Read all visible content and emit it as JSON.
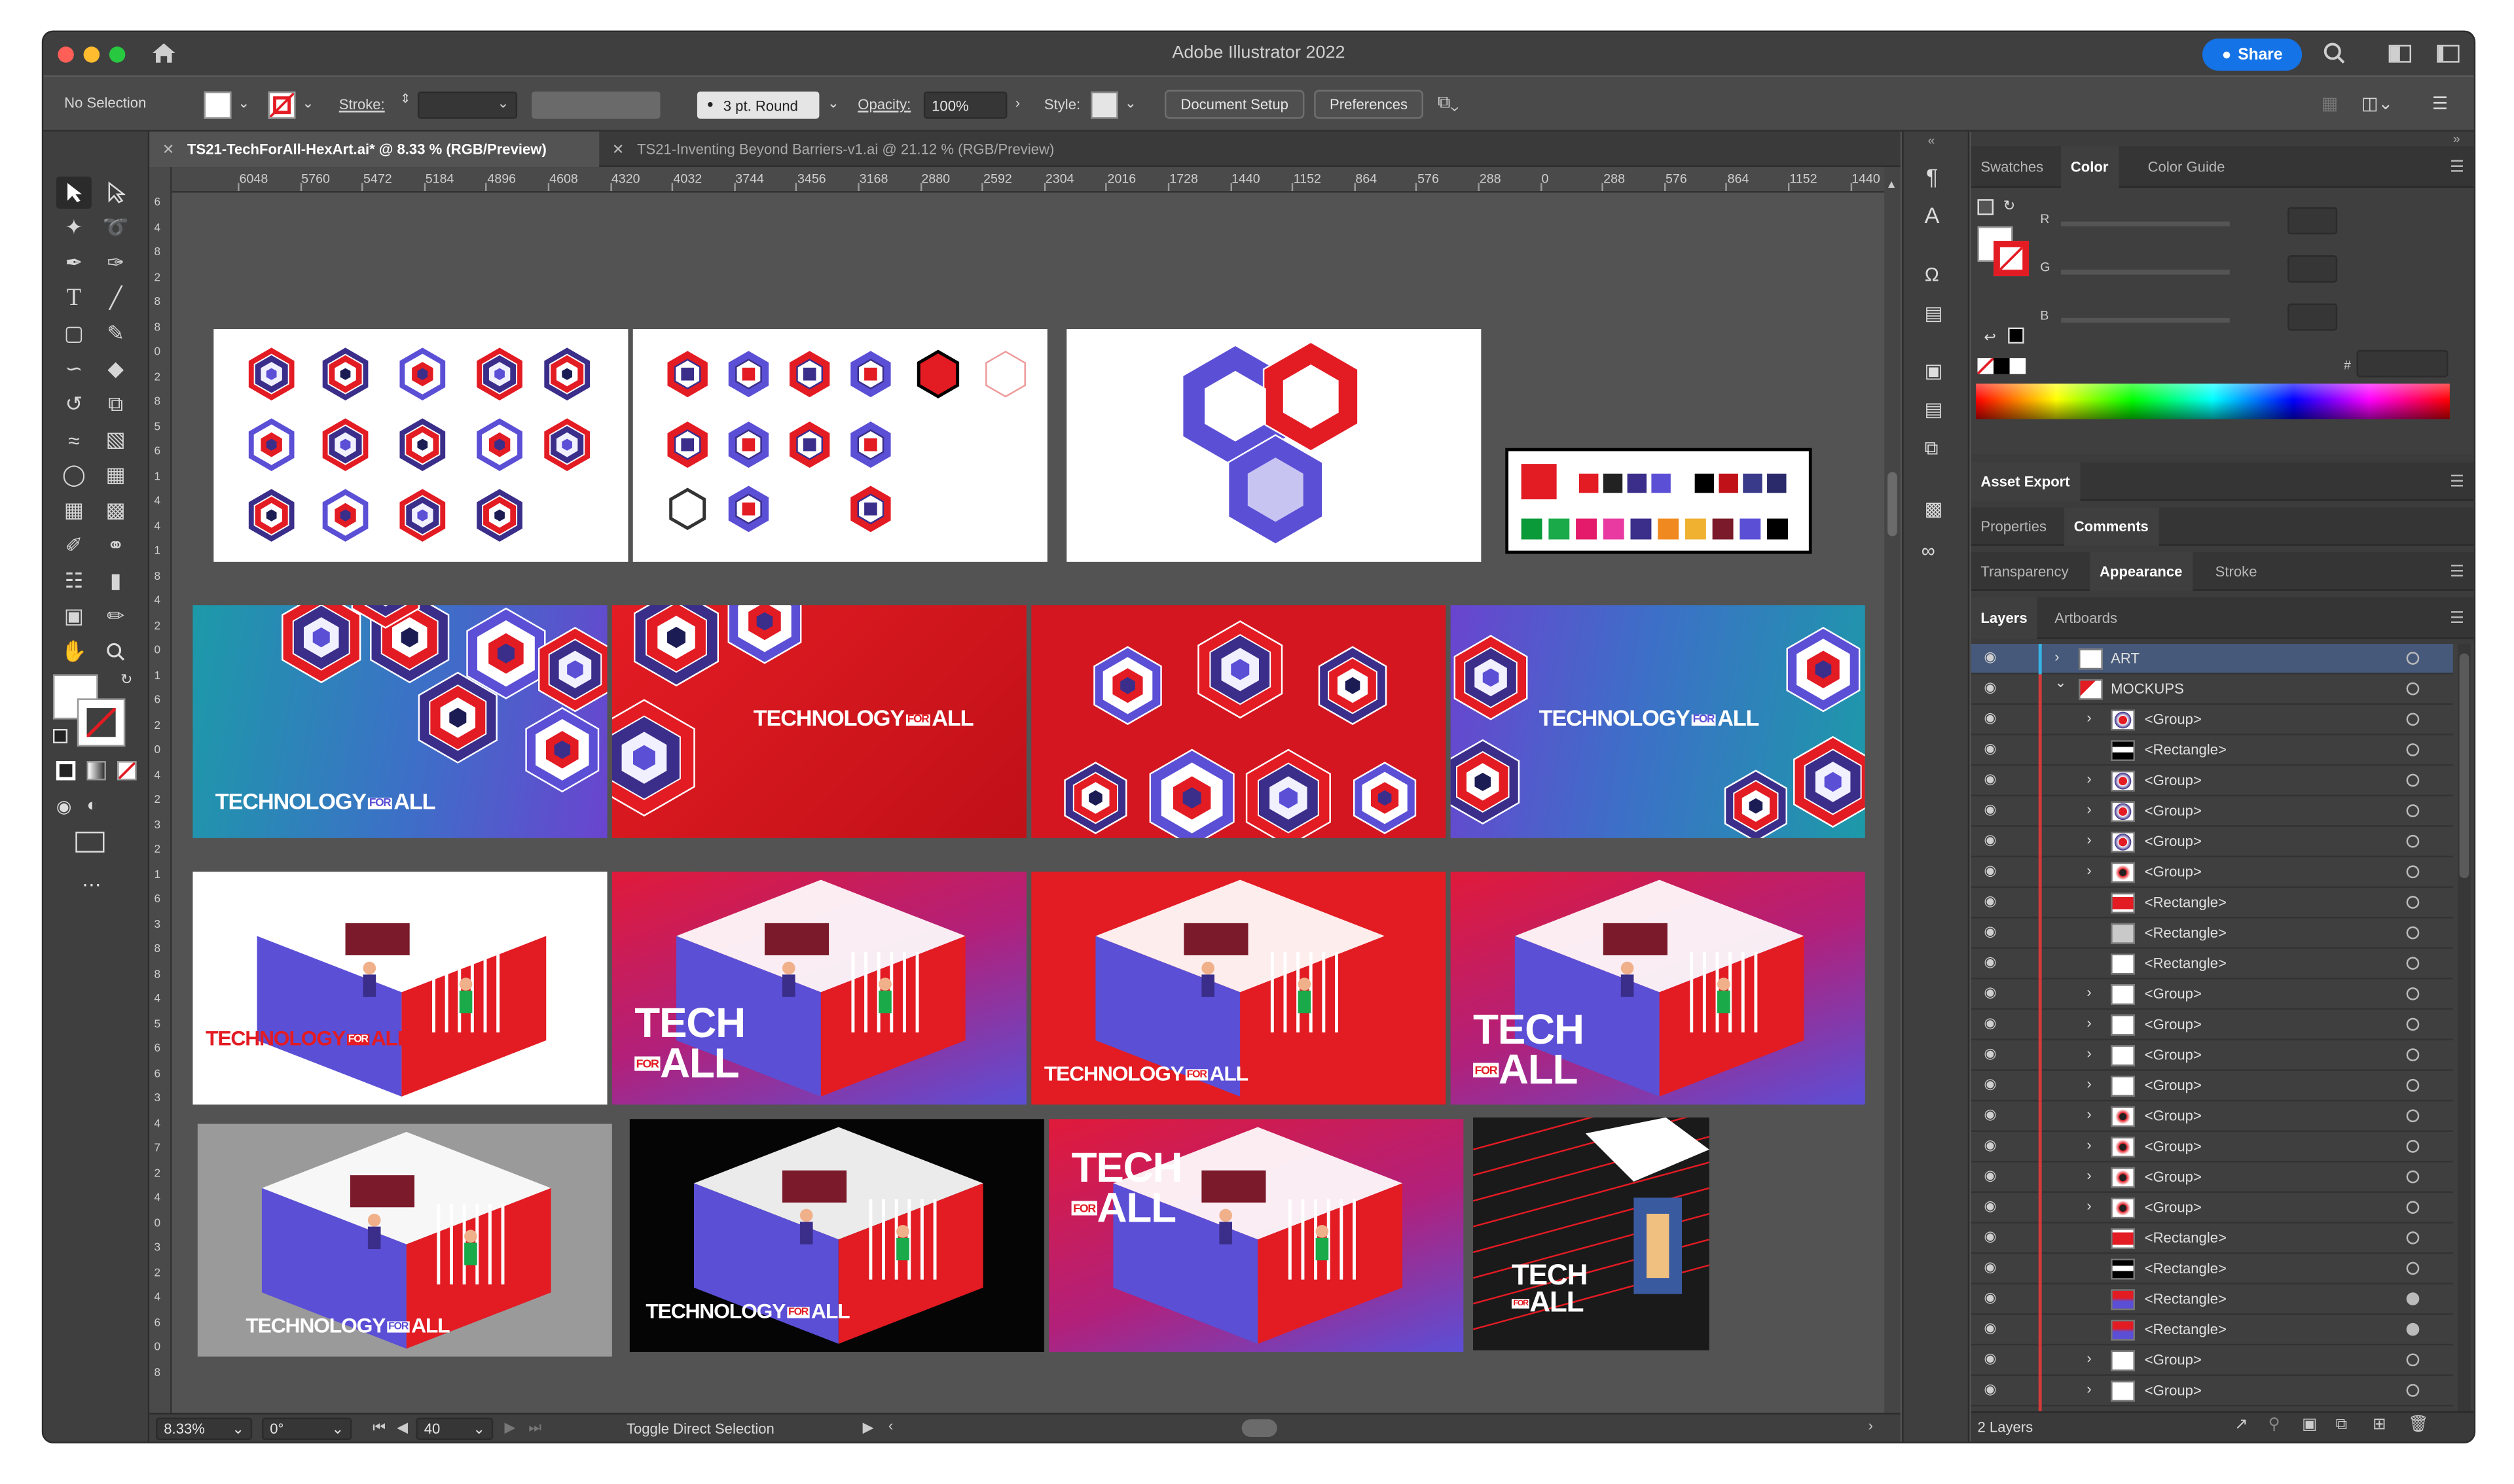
{
  "app": {
    "title": "Adobe Illustrator 2022",
    "share_label": "Share"
  },
  "control_bar": {
    "selection": "No Selection",
    "stroke_label": "Stroke:",
    "brush": "3 pt. Round",
    "opacity_label": "Opacity:",
    "opacity_value": "100%",
    "style_label": "Style:",
    "document_setup": "Document Setup",
    "preferences": "Preferences"
  },
  "tabs": [
    {
      "label": "TS21-TechForAll-HexArt.ai* @ 8.33 % (RGB/Preview)",
      "active": true
    },
    {
      "label": "TS21-Inventing Beyond Barriers-v1.ai @ 21.12 % (RGB/Preview)",
      "active": false
    }
  ],
  "ruler_top": [
    "6048",
    "5760",
    "5472",
    "5184",
    "4896",
    "4608",
    "4320",
    "4032",
    "3744",
    "3456",
    "3168",
    "2880",
    "2592",
    "2304",
    "2016",
    "1728",
    "1440",
    "1152",
    "864",
    "576",
    "288",
    "0",
    "288",
    "576",
    "864",
    "1152",
    "1440"
  ],
  "ruler_left": [
    "6",
    "4",
    "8",
    "2",
    "8",
    "8",
    "0",
    "2",
    "8",
    "5",
    "6",
    "1",
    "4",
    "4",
    "1",
    "8",
    "4",
    "2",
    "0",
    "1",
    "6",
    "2",
    "0",
    "4",
    "2",
    "3",
    "2",
    "1",
    "6",
    "3",
    "8",
    "8",
    "4",
    "5",
    "6",
    "6",
    "3",
    "4",
    "7",
    "2",
    "4",
    "0",
    "3",
    "2",
    "4",
    "6",
    "0",
    "8"
  ],
  "artboards": {
    "banner_text": {
      "technology": "TECHNOLOGY",
      "for": "FOR",
      "all": "ALL",
      "tech": "TECH"
    }
  },
  "status_bar": {
    "zoom": "8.33%",
    "rotation": "0°",
    "artboard_number": "40",
    "tool_hint": "Toggle Direct Selection"
  },
  "right_panel": {
    "color_tabs": [
      "Swatches",
      "Color",
      "Color Guide"
    ],
    "active_color_tab": "Color",
    "channels": [
      "R",
      "G",
      "B"
    ],
    "hex_symbol": "#",
    "asset_export": "Asset Export",
    "prop_tabs": [
      "Properties",
      "Comments"
    ],
    "appearance_tabs": [
      "Transparency",
      "Appearance",
      "Stroke"
    ],
    "layer_tabs": [
      "Layers",
      "Artboards"
    ],
    "layers": [
      {
        "name": "ART",
        "level": 0,
        "expand": "right",
        "thumb": "art"
      },
      {
        "name": "MOCKUPS",
        "level": 0,
        "expand": "down",
        "thumb": "mock"
      },
      {
        "name": "<Group>",
        "level": 1,
        "expand": "right",
        "thumb": "hexred"
      },
      {
        "name": "<Rectangle>",
        "level": 1,
        "expand": "",
        "thumb": "stripe"
      },
      {
        "name": "<Group>",
        "level": 1,
        "expand": "right",
        "thumb": "hexred"
      },
      {
        "name": "<Group>",
        "level": 1,
        "expand": "right",
        "thumb": "hexred"
      },
      {
        "name": "<Group>",
        "level": 1,
        "expand": "right",
        "thumb": "hexred"
      },
      {
        "name": "<Group>",
        "level": 1,
        "expand": "right",
        "thumb": "hexdark"
      },
      {
        "name": "<Rectangle>",
        "level": 1,
        "expand": "",
        "thumb": "red"
      },
      {
        "name": "<Rectangle>",
        "level": 1,
        "expand": "",
        "thumb": "grey"
      },
      {
        "name": "<Rectangle>",
        "level": 1,
        "expand": "",
        "thumb": "white"
      },
      {
        "name": "<Group>",
        "level": 1,
        "expand": "right",
        "thumb": "white"
      },
      {
        "name": "<Group>",
        "level": 1,
        "expand": "right",
        "thumb": "white"
      },
      {
        "name": "<Group>",
        "level": 1,
        "expand": "right",
        "thumb": "white"
      },
      {
        "name": "<Group>",
        "level": 1,
        "expand": "right",
        "thumb": "white"
      },
      {
        "name": "<Group>",
        "level": 1,
        "expand": "right",
        "thumb": "hexdark"
      },
      {
        "name": "<Group>",
        "level": 1,
        "expand": "right",
        "thumb": "hexdark"
      },
      {
        "name": "<Group>",
        "level": 1,
        "expand": "right",
        "thumb": "hexdark"
      },
      {
        "name": "<Group>",
        "level": 1,
        "expand": "right",
        "thumb": "hexdark"
      },
      {
        "name": "<Rectangle>",
        "level": 1,
        "expand": "",
        "thumb": "red"
      },
      {
        "name": "<Rectangle>",
        "level": 1,
        "expand": "",
        "thumb": "stripe"
      },
      {
        "name": "<Rectangle>",
        "level": 1,
        "expand": "",
        "thumb": "flag"
      },
      {
        "name": "<Rectangle>",
        "level": 1,
        "expand": "",
        "thumb": "flag"
      },
      {
        "name": "<Group>",
        "level": 1,
        "expand": "right",
        "thumb": "white"
      },
      {
        "name": "<Group>",
        "level": 1,
        "expand": "right",
        "thumb": "white"
      },
      {
        "name": "<Group>",
        "level": 1,
        "expand": "right",
        "thumb": "white"
      }
    ],
    "layer_count": "2 Layers"
  },
  "colors": {
    "brand_red": "#e31b23",
    "brand_purple": "#5b4fd6",
    "brand_teal": "#1c9aa8",
    "accent_blue": "#2f7cf6",
    "panel_bg": "#3c3c3c"
  }
}
